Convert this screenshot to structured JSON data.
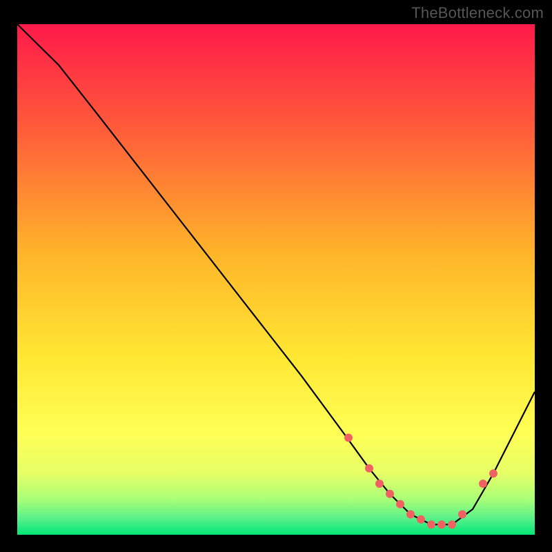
{
  "attribution": "TheBottleneck.com",
  "colors": {
    "top": "#ff1a4a",
    "mid_orange": "#ffa42a",
    "yellow": "#ffff3a",
    "green_light": "#9bff7a",
    "green": "#00e676",
    "curve": "#000000",
    "marker": "#f06262",
    "frame": "#000000"
  },
  "chart_data": {
    "type": "line",
    "title": "",
    "xlabel": "",
    "ylabel": "",
    "xlim": [
      0,
      100
    ],
    "ylim": [
      0,
      100
    ],
    "curve": {
      "x": [
        0,
        4,
        8,
        15,
        25,
        35,
        45,
        55,
        63,
        68,
        72,
        76,
        80,
        84,
        88,
        92,
        100
      ],
      "y": [
        100,
        96,
        92,
        83,
        70,
        57,
        44,
        31,
        20,
        13,
        8,
        4,
        2,
        2,
        5,
        12,
        28
      ]
    },
    "markers": {
      "x": [
        64,
        68,
        70,
        72,
        74,
        76,
        78,
        80,
        82,
        84,
        86,
        90,
        92
      ],
      "y": [
        19,
        13,
        10,
        8,
        6,
        4,
        3,
        2,
        2,
        2,
        4,
        10,
        12
      ]
    },
    "gradient_stops": [
      {
        "offset": 0.0,
        "color": "#ff1a4a"
      },
      {
        "offset": 0.2,
        "color": "#ff5a3a"
      },
      {
        "offset": 0.45,
        "color": "#ffb52a"
      },
      {
        "offset": 0.65,
        "color": "#ffe733"
      },
      {
        "offset": 0.8,
        "color": "#ffff55"
      },
      {
        "offset": 0.88,
        "color": "#e6ff66"
      },
      {
        "offset": 0.93,
        "color": "#aaff77"
      },
      {
        "offset": 0.97,
        "color": "#55f08a"
      },
      {
        "offset": 1.0,
        "color": "#00e676"
      }
    ]
  }
}
